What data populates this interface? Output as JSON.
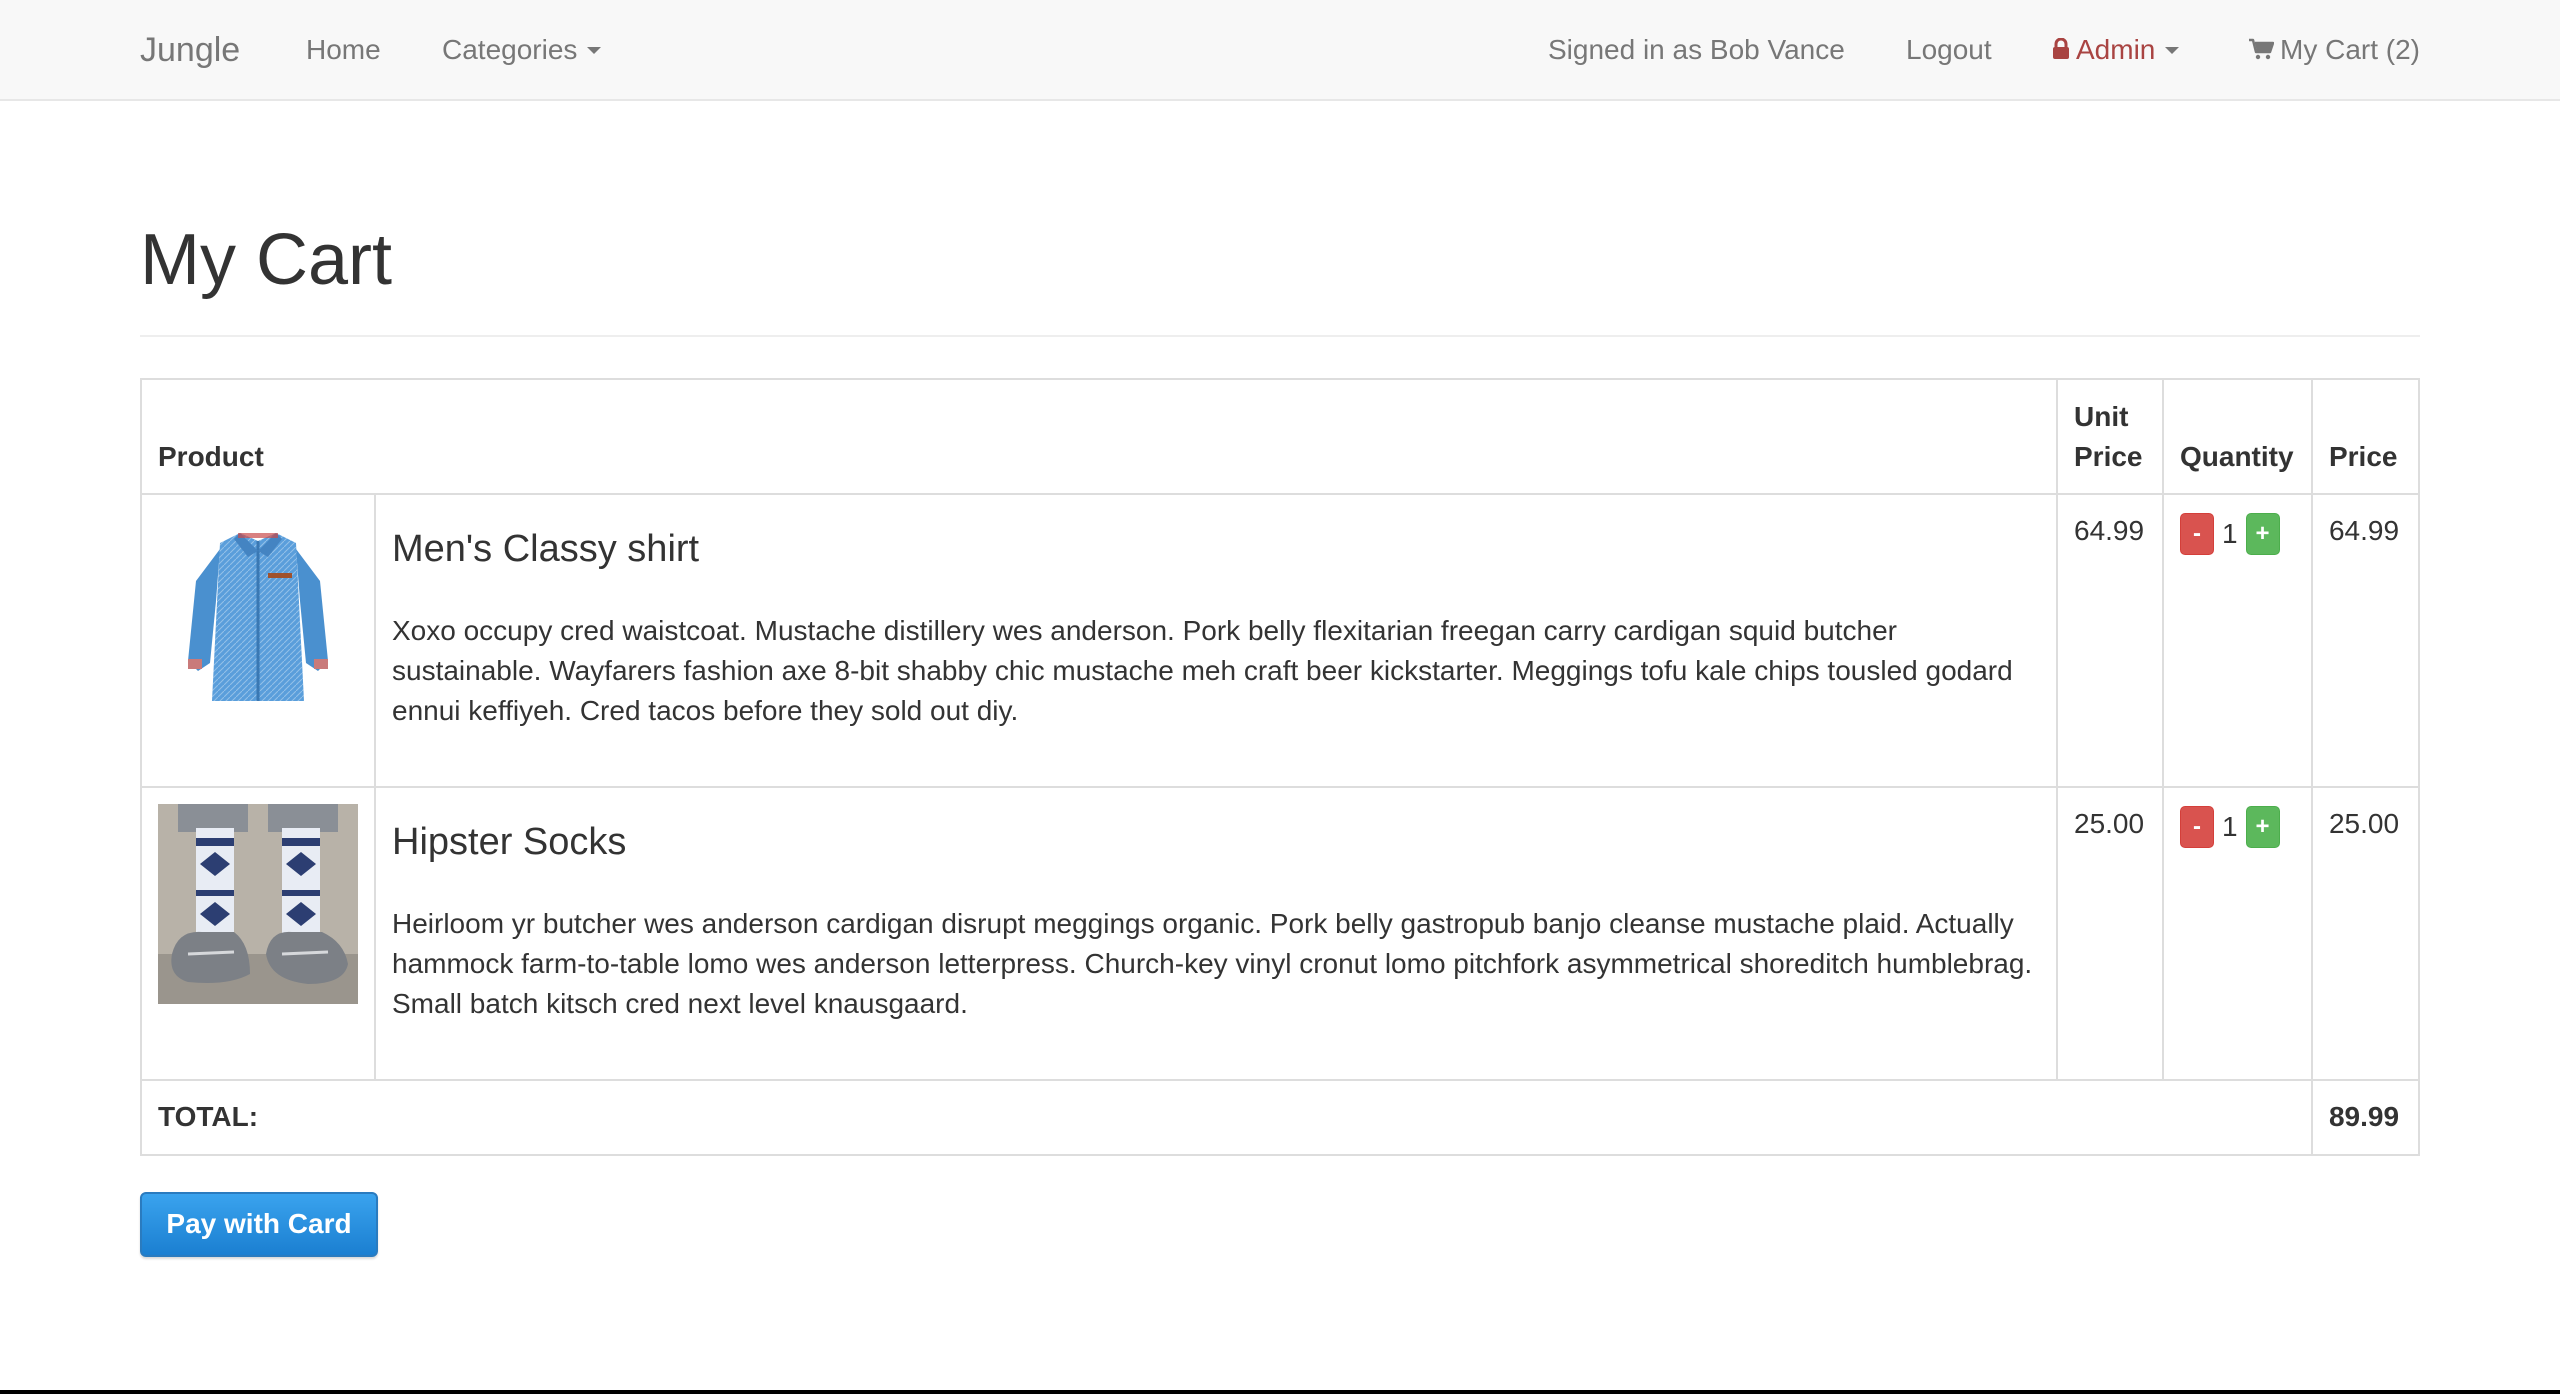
{
  "navbar": {
    "brand": "Jungle",
    "home": "Home",
    "categories": "Categories",
    "signed_in": "Signed in as Bob Vance",
    "logout": "Logout",
    "admin": "Admin",
    "cart": "My Cart (2)"
  },
  "page": {
    "title": "My Cart"
  },
  "table": {
    "headers": {
      "product": "Product",
      "unit_price_line1": "Unit",
      "unit_price_line2": "Price",
      "quantity": "Quantity",
      "price": "Price"
    },
    "items": [
      {
        "name": "Men's Classy shirt",
        "description": "Xoxo occupy cred waistcoat. Mustache distillery wes anderson. Pork belly flexitarian freegan carry cardigan squid butcher sustainable. Wayfarers fashion axe 8-bit shabby chic mustache meh craft beer kickstarter. Meggings tofu kale chips tousled godard ennui keffiyeh. Cred tacos before they sold out diy.",
        "unit_price": "64.99",
        "quantity": "1",
        "price": "64.99",
        "minus": "-",
        "plus": "+"
      },
      {
        "name": "Hipster Socks",
        "description": "Heirloom yr butcher wes anderson cardigan disrupt meggings organic. Pork belly gastropub banjo cleanse mustache plaid. Actually hammock farm-to-table lomo wes anderson letterpress. Church-key vinyl cronut lomo pitchfork asymmetrical shoreditch humblebrag. Small batch kitsch cred next level knausgaard.",
        "unit_price": "25.00",
        "quantity": "1",
        "price": "25.00",
        "minus": "-",
        "plus": "+"
      }
    ],
    "total_label": "TOTAL:",
    "total_value": "89.99"
  },
  "actions": {
    "pay_label": "Pay with Card"
  },
  "colors": {
    "navbar_bg": "#f8f8f8",
    "admin": "#a94442",
    "minus_btn": "#d9534f",
    "plus_btn": "#5cb85c",
    "pay_btn": "#2a8ee0"
  },
  "icons": {
    "admin": "lock-icon",
    "cart": "shopping-cart-icon",
    "dropdown": "caret-down-icon"
  }
}
